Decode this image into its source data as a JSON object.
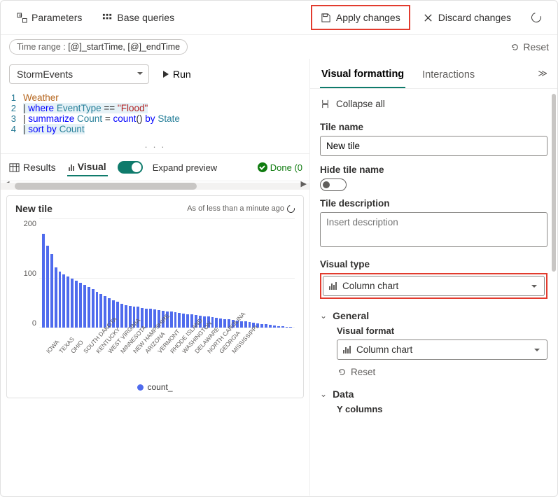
{
  "toolbar": {
    "parameters": "Parameters",
    "base_queries": "Base queries",
    "apply": "Apply changes",
    "discard": "Discard changes",
    "reset": "Reset"
  },
  "time_range": {
    "prefix": "Time range : ",
    "value": "[@]_startTime, [@]_endTime"
  },
  "query": {
    "datasource": "StormEvents",
    "run": "Run",
    "lines": [
      {
        "n": "1",
        "html": "<span class='tk-tbl'>Weather</span>"
      },
      {
        "n": "2",
        "html": "<span class='hl'><span class='tk-pipe'>| </span><span class='tk-kw'>where</span> <span class='tk-col'>EventType</span> <span class='tk-op'>==</span> <span class='tk-str'>\"Flood\"</span></span>"
      },
      {
        "n": "3",
        "html": "<span class='tk-pipe'>| </span><span class='tk-kw'>summarize</span> <span class='tk-col'>Count</span> <span class='tk-op'>=</span> <span class='tk-fn'>count</span>() <span class='tk-kw'>by</span> <span class='tk-col'>State</span>"
      },
      {
        "n": "4",
        "html": "<span class='hl'><span class='tk-pipe'>| </span><span class='tk-kw'>sort</span> <span class='tk-kw'>by</span> <span class='tk-col'>Count</span></span>"
      }
    ]
  },
  "tabs": {
    "results": "Results",
    "visual": "Visual",
    "expand": "Expand preview",
    "done": "Done (0"
  },
  "tile": {
    "title": "New tile",
    "asof": "As of less than a minute ago",
    "legend": "count_"
  },
  "chart_data": {
    "type": "bar",
    "title": "New tile",
    "xlabel": "",
    "ylabel": "",
    "ylim": [
      0,
      200
    ],
    "yticks": [
      0,
      100,
      200
    ],
    "legend": [
      "count_"
    ],
    "labeled_categories": [
      "IOWA",
      "TEXAS",
      "OHIO",
      "SOUTH DAKOTA",
      "KENTUCKY",
      "WEST VIRGINIA",
      "MINNESOTA",
      "NEW HAMPSHIRE",
      "ARIZONA",
      "VERMONT",
      "RHODE ISLAND",
      "WASHINGTON",
      "DELAWARE",
      "NORTH CAROLINA",
      "GEORGIA",
      "MISSISSIPPI"
    ],
    "values": [
      172,
      150,
      134,
      110,
      102,
      98,
      94,
      90,
      86,
      82,
      78,
      74,
      70,
      66,
      62,
      58,
      54,
      50,
      47,
      44,
      41,
      40,
      39,
      38,
      36,
      35,
      34,
      33,
      32,
      31,
      30,
      29,
      28,
      27,
      26,
      25,
      24,
      23,
      22,
      21,
      20,
      19,
      18,
      17,
      16,
      15,
      14,
      13,
      12,
      11,
      10,
      9,
      8,
      7,
      6,
      5,
      4,
      3,
      2,
      1,
      1
    ]
  },
  "right": {
    "visual_formatting": "Visual formatting",
    "interactions": "Interactions",
    "collapse_all": "Collapse all",
    "tile_name_label": "Tile name",
    "tile_name_value": "New tile",
    "hide_tile_label": "Hide tile name",
    "tile_desc_label": "Tile description",
    "tile_desc_placeholder": "Insert description",
    "visual_type_label": "Visual type",
    "visual_type_value": "Column chart",
    "general": "General",
    "visual_format_label": "Visual format",
    "visual_format_value": "Column chart",
    "reset": "Reset",
    "data": "Data",
    "y_columns": "Y columns"
  }
}
